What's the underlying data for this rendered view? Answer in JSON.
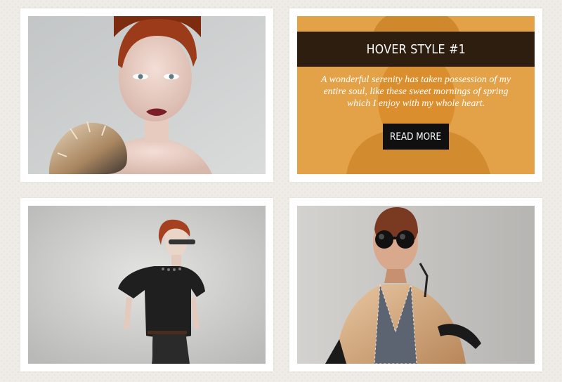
{
  "gallery": {
    "items": [
      {
        "photo": "Portrait of red-haired model with fur stole"
      },
      {
        "hover": {
          "title": "HOVER STYLE #1",
          "text": "A wonderful serenity has taken possession of my entire soul, like these sweet mornings of spring which I enjoy with my whole heart.",
          "button": "READ MORE"
        }
      },
      {
        "photo": "Model in black dress wearing sunglasses"
      },
      {
        "photo": "Model in leather cap, round goggles and tan jacket"
      }
    ]
  },
  "colors": {
    "page_background": "#efebe7",
    "card_background": "#ffffff",
    "overlay_accent": "#e59a2e",
    "title_bar": "#2e1e10",
    "button": "#101010"
  }
}
